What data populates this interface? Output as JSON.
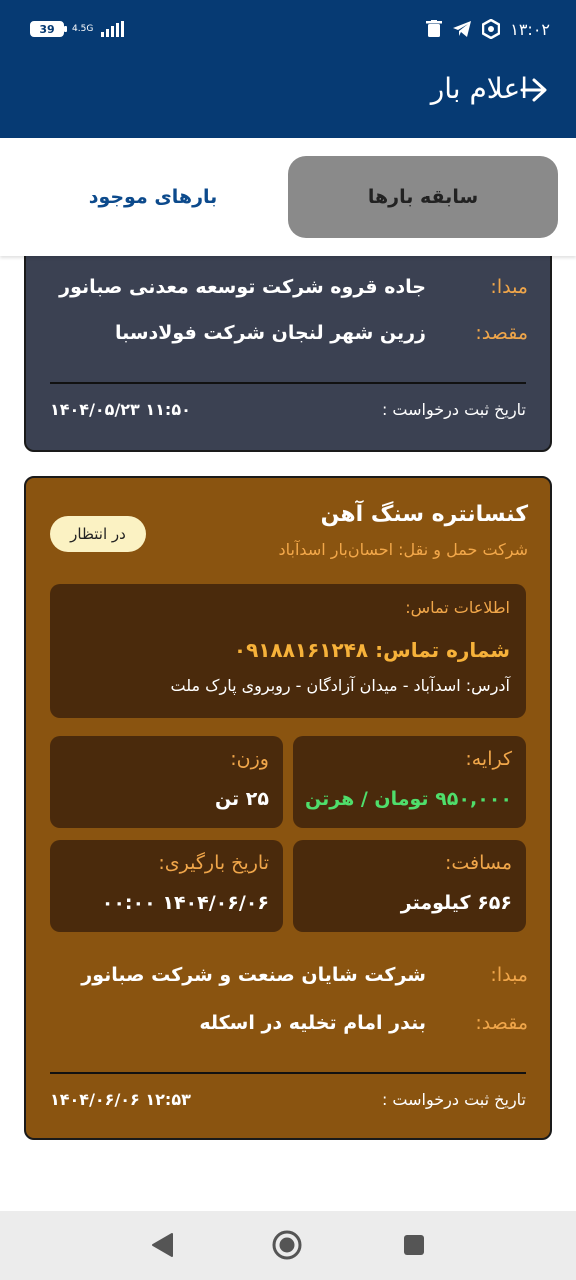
{
  "status_bar": {
    "time": "۱۳:۰۲",
    "battery": "39",
    "network": "4.5G"
  },
  "app_bar": {
    "title": "اعلام بار"
  },
  "tabs": {
    "history": "سابقه بارها",
    "available": "بارهای موجود"
  },
  "cards": [
    {
      "origin_label": "مبدا:",
      "origin": "جاده قروه شرکت توسعه معدنی صبانور",
      "destination_label": "مقصد:",
      "destination": "زرین شهر لنجان شرکت فولادسبا",
      "registered_label": "تاریخ ثبت درخواست :",
      "registered_at": "۱۴۰۴/۰۵/۲۳ ۱۱:۵۰"
    },
    {
      "title": "کنسانتره سنگ آهن",
      "carrier": "شرکت حمل و نقل: احسان‌بار اسدآباد",
      "status": "در انتظار",
      "contact_label": "اطلاعات تماس:",
      "phone": "شماره تماس: ۰۹۱۸۸۱۶۱۲۴۸",
      "address": "آدرس: اسدآباد - میدان آزادگان - روبروی پارک ملت",
      "fare_label": "کرایه:",
      "fare": "۹۵۰,۰۰۰ تومان / هرتن",
      "weight_label": "وزن:",
      "weight": "۲۵ تن",
      "distance_label": "مسافت:",
      "distance": "۶۵۶ کیلومتر",
      "loading_label": "تاریخ بارگیری:",
      "loading_date": "۱۴۰۴/۰۶/۰۶ ۰۰:۰۰",
      "origin_label": "مبدا:",
      "origin": "شرکت شایان صنعت و شرکت  صبانور",
      "destination_label": "مقصد:",
      "destination": "بندر امام تخلیه در اسکله",
      "registered_label": "تاریخ ثبت درخواست :",
      "registered_at": "۱۴۰۴/۰۶/۰۶ ۱۲:۵۳"
    }
  ],
  "colors": {
    "app_bar": "#063a73",
    "active_tab": "#8a8a8a",
    "card_dark": "#3b4152",
    "card_brown": "#8a5410",
    "accent_orange": "#f0a64a",
    "fare_green": "#4fde6b"
  }
}
